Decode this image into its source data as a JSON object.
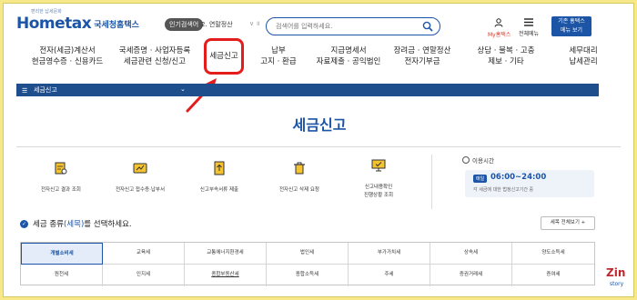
{
  "logo": {
    "brand": "Hometax",
    "korean": "국세청홈택스",
    "tagline": "편리한 납세문화"
  },
  "popular": {
    "badge": "인기검색어",
    "item": "2. 연말정산",
    "controls": "∨ ॥"
  },
  "search": {
    "placeholder": "검색어를 입력하세요."
  },
  "header": {
    "mytax": "My홈택스",
    "allmenu": "전체메뉴",
    "mobile_line1": "기존 홈택스",
    "mobile_line2": "메뉴 보기"
  },
  "gnb": [
    {
      "line1": "전자(세금)계산서",
      "line2": "현금영수증 · 신용카드"
    },
    {
      "line1": "국세증명 · 사업자등록",
      "line2": "세금관련 신청/신고"
    },
    {
      "line1": "세금신고",
      "line2": ""
    },
    {
      "line1": "납부",
      "line2": "고지 · 환급"
    },
    {
      "line1": "지급명세서",
      "line2": "자료제출 · 공익법인"
    },
    {
      "line1": "장려금 · 연말정산",
      "line2": "전자기부금"
    },
    {
      "line1": "상담 · 불복 · 고충",
      "line2": "제보 · 기타"
    },
    {
      "line1": "세무대리",
      "line2": "납세관리"
    }
  ],
  "breadcrumb": {
    "menu": "☰",
    "label": "세금신고",
    "chevron": "⌄"
  },
  "page_title": "세금신고",
  "services": [
    {
      "label1": "전자신고 결과 조회",
      "label2": ""
    },
    {
      "label1": "전자신고 접수증·납부서",
      "label2": ""
    },
    {
      "label1": "신고부속서류 제출",
      "label2": ""
    },
    {
      "label1": "전자신고 삭제 요청",
      "label2": ""
    },
    {
      "label1": "신고내용확인",
      "label2": "진행상황 조회"
    }
  ],
  "usage": {
    "title": "이용시간",
    "badge": "매일",
    "time": "06:00~24:00",
    "note": "각 세금에 대한 법정신고기간 중"
  },
  "tax_type": {
    "prefix": "세금 종류",
    "highlight": "(세목)",
    "suffix": "를 선택하세요.",
    "view_all": "세목 전체보기 +"
  },
  "tax_grid": [
    "개별소비세",
    "교육세",
    "교통에너지환경세",
    "법인세",
    "부가가치세",
    "상속세",
    "양도소득세",
    "원천세",
    "인지세",
    "종합부동산세",
    "종합소득세",
    "주세",
    "증권거래세",
    "증여세"
  ],
  "watermark": {
    "line1": "Zin",
    "line2": "story"
  },
  "colors": {
    "brand_blue": "#1c54a6",
    "highlight_red": "#e51c1c",
    "frame_bg": "#f7e98a"
  }
}
